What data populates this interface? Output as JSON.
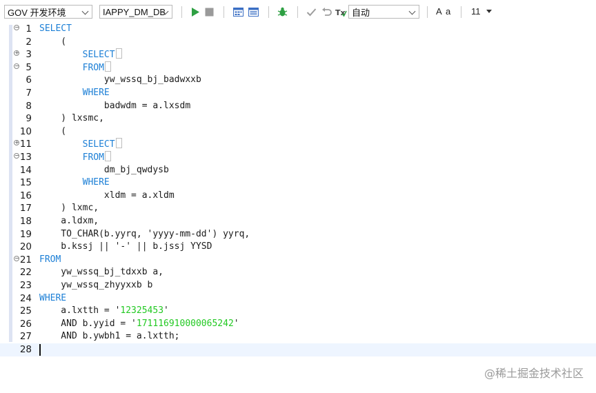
{
  "toolbar": {
    "connection": "GOV 开发环境",
    "schema": "IAPPY_DM_DB",
    "mode": "自动",
    "font_label_a1": "A",
    "font_label_a2": "a",
    "font_size": "11"
  },
  "icons": {
    "run": "play-icon",
    "stop": "stop-icon",
    "explain": "explain-plan-icon",
    "calendar": "calendar-icon",
    "debug": "bug-icon",
    "commit": "check-icon",
    "rollback": "undo-icon",
    "transaction": "transaction-icon"
  },
  "colors": {
    "keyword": "#1c7fd6",
    "string": "#22c922",
    "run": "#2ea043"
  },
  "editor": {
    "lines": [
      {
        "n": "1",
        "parts": [
          {
            "k": "kw",
            "t": "SELECT"
          }
        ]
      },
      {
        "n": "2",
        "parts": [
          {
            "k": "",
            "t": "    ("
          }
        ]
      },
      {
        "n": "3",
        "parts": [
          {
            "k": "",
            "t": "        "
          },
          {
            "k": "kw",
            "t": "SELECT"
          },
          {
            "k": "box",
            "t": ""
          }
        ]
      },
      {
        "n": "5",
        "parts": [
          {
            "k": "",
            "t": "        "
          },
          {
            "k": "kw",
            "t": "FROM"
          },
          {
            "k": "box",
            "t": ""
          }
        ]
      },
      {
        "n": "6",
        "parts": [
          {
            "k": "",
            "t": "            yw_wssq_bj_badwxxb"
          }
        ]
      },
      {
        "n": "7",
        "parts": [
          {
            "k": "",
            "t": "        "
          },
          {
            "k": "kw",
            "t": "WHERE"
          }
        ]
      },
      {
        "n": "8",
        "parts": [
          {
            "k": "",
            "t": "            badwdm = a.lxsdm"
          }
        ]
      },
      {
        "n": "9",
        "parts": [
          {
            "k": "",
            "t": "    ) lxsmc,"
          }
        ]
      },
      {
        "n": "10",
        "parts": [
          {
            "k": "",
            "t": "    ("
          }
        ]
      },
      {
        "n": "11",
        "parts": [
          {
            "k": "",
            "t": "        "
          },
          {
            "k": "kw",
            "t": "SELECT"
          },
          {
            "k": "box",
            "t": ""
          }
        ]
      },
      {
        "n": "13",
        "parts": [
          {
            "k": "",
            "t": "        "
          },
          {
            "k": "kw",
            "t": "FROM"
          },
          {
            "k": "box",
            "t": ""
          }
        ]
      },
      {
        "n": "14",
        "parts": [
          {
            "k": "",
            "t": "            dm_bj_qwdysb"
          }
        ]
      },
      {
        "n": "15",
        "parts": [
          {
            "k": "",
            "t": "        "
          },
          {
            "k": "kw",
            "t": "WHERE"
          }
        ]
      },
      {
        "n": "16",
        "parts": [
          {
            "k": "",
            "t": "            xldm = a.xldm"
          }
        ]
      },
      {
        "n": "17",
        "parts": [
          {
            "k": "",
            "t": "    ) lxmc,"
          }
        ]
      },
      {
        "n": "18",
        "parts": [
          {
            "k": "",
            "t": "    a.ldxm,"
          }
        ]
      },
      {
        "n": "19",
        "parts": [
          {
            "k": "",
            "t": "    TO_CHAR(b.yyrq, 'yyyy-mm-dd') yyrq,"
          }
        ]
      },
      {
        "n": "20",
        "parts": [
          {
            "k": "",
            "t": "    b.kssj || '-' || b.jssj YYSD"
          }
        ]
      },
      {
        "n": "21",
        "parts": [
          {
            "k": "kw",
            "t": "FROM"
          }
        ]
      },
      {
        "n": "22",
        "parts": [
          {
            "k": "",
            "t": "    yw_wssq_bj_tdxxb a,"
          }
        ]
      },
      {
        "n": "23",
        "parts": [
          {
            "k": "",
            "t": "    yw_wssq_zhyyxxb b"
          }
        ]
      },
      {
        "n": "24",
        "parts": [
          {
            "k": "kw",
            "t": "WHERE"
          }
        ]
      },
      {
        "n": "25",
        "parts": [
          {
            "k": "",
            "t": "    a.lxtth = '"
          },
          {
            "k": "str-g",
            "t": "12325453"
          },
          {
            "k": "",
            "t": "'"
          }
        ]
      },
      {
        "n": "26",
        "parts": [
          {
            "k": "",
            "t": "    AND b.yyid = '"
          },
          {
            "k": "str-g",
            "t": "171116910000065242"
          },
          {
            "k": "",
            "t": "'"
          }
        ]
      },
      {
        "n": "27",
        "parts": [
          {
            "k": "",
            "t": "    AND b.ywbh1 = a.lxtth;"
          }
        ]
      },
      {
        "n": "28",
        "parts": []
      }
    ]
  },
  "watermark": "@稀土掘金技术社区"
}
